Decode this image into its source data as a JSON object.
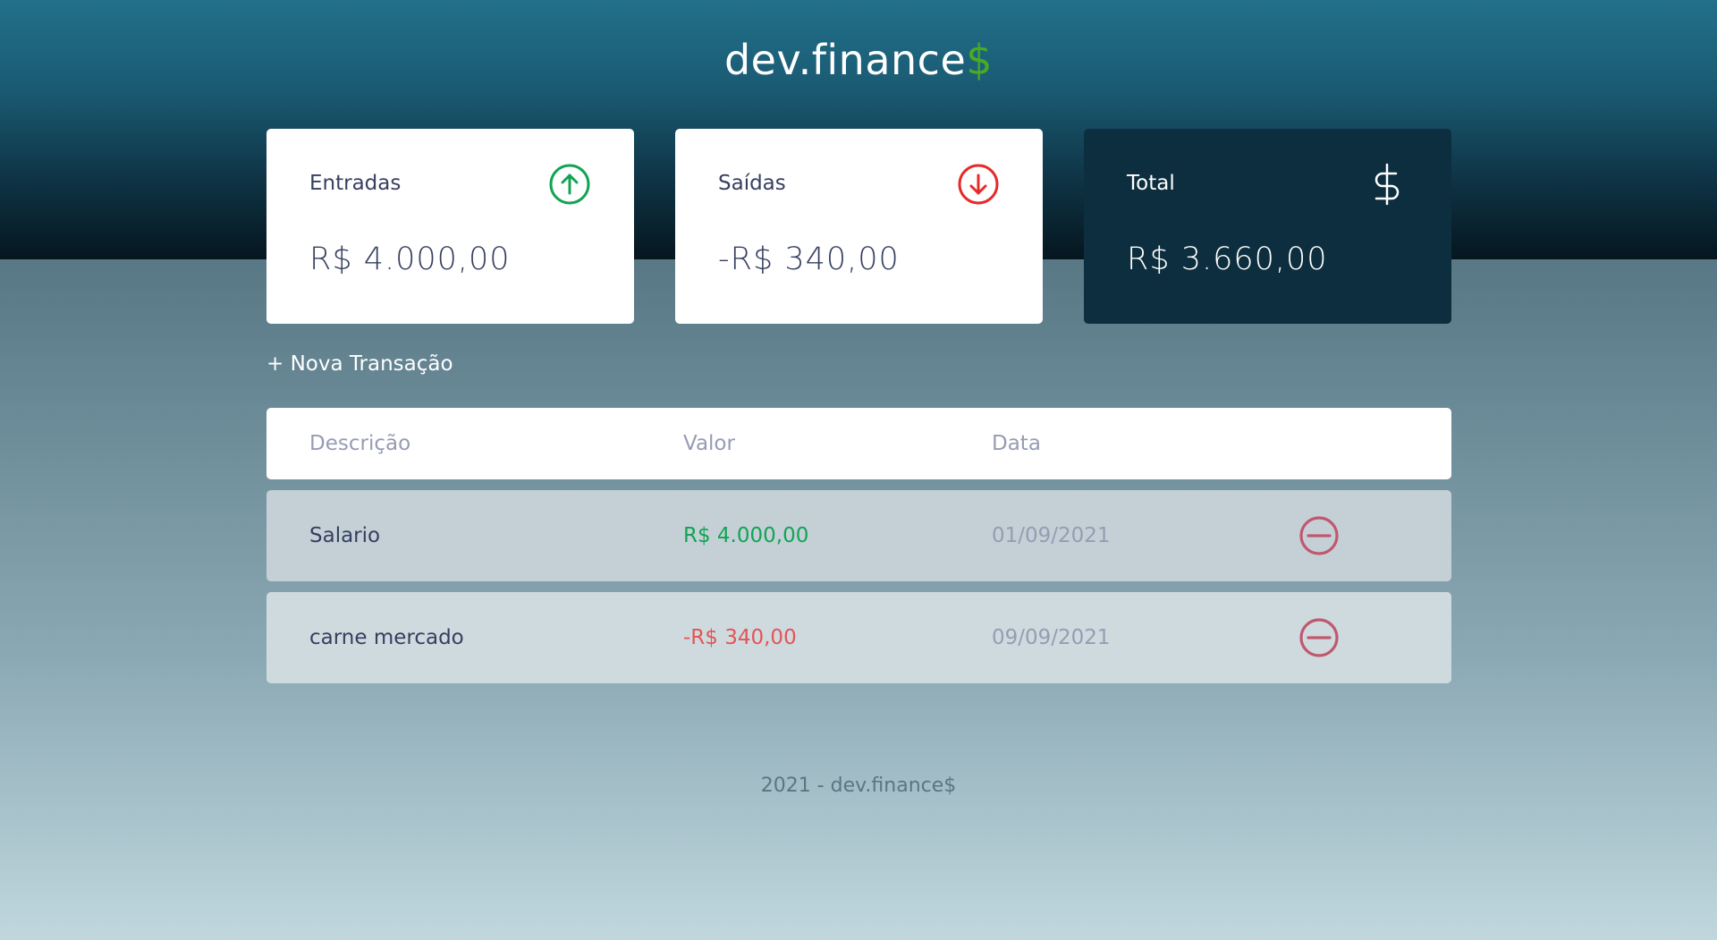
{
  "app": {
    "logo_main": "dev.finance",
    "logo_accent": "$",
    "colors": {
      "income": "#12a454",
      "expense": "#e92929",
      "brand_green": "#49aa26",
      "total_card": "#0d2e3f"
    }
  },
  "cards": {
    "income": {
      "label": "Entradas",
      "value": "R$ 4.000,00",
      "icon": "arrow-up-circle-icon"
    },
    "expense": {
      "label": "Saídas",
      "value": "-R$ 340,00",
      "icon": "arrow-down-circle-icon"
    },
    "total": {
      "label": "Total",
      "value": "R$ 3.660,00",
      "icon": "dollar-icon"
    }
  },
  "new_transaction_label": "+ Nova Transação",
  "table": {
    "headers": {
      "description": "Descrição",
      "value": "Valor",
      "date": "Data"
    },
    "rows": [
      {
        "description": "Salario",
        "value": "R$ 4.000,00",
        "date": "01/09/2021",
        "type": "income"
      },
      {
        "description": "carne mercado",
        "value": "-R$ 340,00",
        "date": "09/09/2021",
        "type": "expense"
      }
    ]
  },
  "footer": "2021 - dev.finance$"
}
